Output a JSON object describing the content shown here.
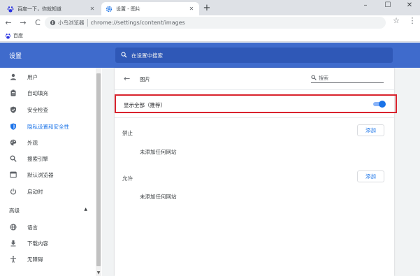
{
  "tabs": [
    {
      "title": "百度一下，你就知道",
      "active": false,
      "icon": "baidu-paw-icon"
    },
    {
      "title": "设置 - 图片",
      "active": true,
      "icon": "gear-icon"
    }
  ],
  "new_tab_label": "+",
  "window_controls": {
    "minimize": "–",
    "maximize": "☐",
    "close": "✕"
  },
  "toolbar": {
    "back": "←",
    "forward": "→",
    "reload": "C",
    "site_name": "小鸟浏览器",
    "url": "chrome://settings/content/images",
    "star": "☆",
    "menu": "⋮"
  },
  "bookmarks": [
    {
      "label": "百度",
      "icon": "baidu-paw-icon"
    }
  ],
  "header": {
    "title": "设置",
    "search_placeholder": "在设置中搜索"
  },
  "sidebar": {
    "items": [
      {
        "label": "用户",
        "icon": "person-icon"
      },
      {
        "label": "自动填充",
        "icon": "clipboard-icon"
      },
      {
        "label": "安全检查",
        "icon": "shield-check-icon"
      },
      {
        "label": "隐私设置和安全性",
        "icon": "shield-icon",
        "selected": true
      },
      {
        "label": "外观",
        "icon": "palette-icon"
      },
      {
        "label": "搜索引擎",
        "icon": "search-icon"
      },
      {
        "label": "默认浏览器",
        "icon": "browser-icon"
      },
      {
        "label": "启动时",
        "icon": "power-icon"
      }
    ],
    "advanced_label": "高级",
    "advanced_toggle": "▲",
    "advanced_items": [
      {
        "label": "语言",
        "icon": "globe-icon"
      },
      {
        "label": "下载内容",
        "icon": "download-icon"
      },
      {
        "label": "无障碍",
        "icon": "accessibility-icon"
      }
    ]
  },
  "page": {
    "title": "图片",
    "search_placeholder": "搜索",
    "show_all_label": "显示全部（推荐）",
    "show_all_enabled": true,
    "block_section": {
      "label": "禁止",
      "add_label": "添加",
      "empty_text": "未添加任何网站"
    },
    "allow_section": {
      "label": "允许",
      "add_label": "添加",
      "empty_text": "未添加任何网站"
    }
  },
  "colors": {
    "header_bg": "#3f6bcc",
    "accent": "#1a73e8",
    "highlight_border": "#d9232d"
  }
}
